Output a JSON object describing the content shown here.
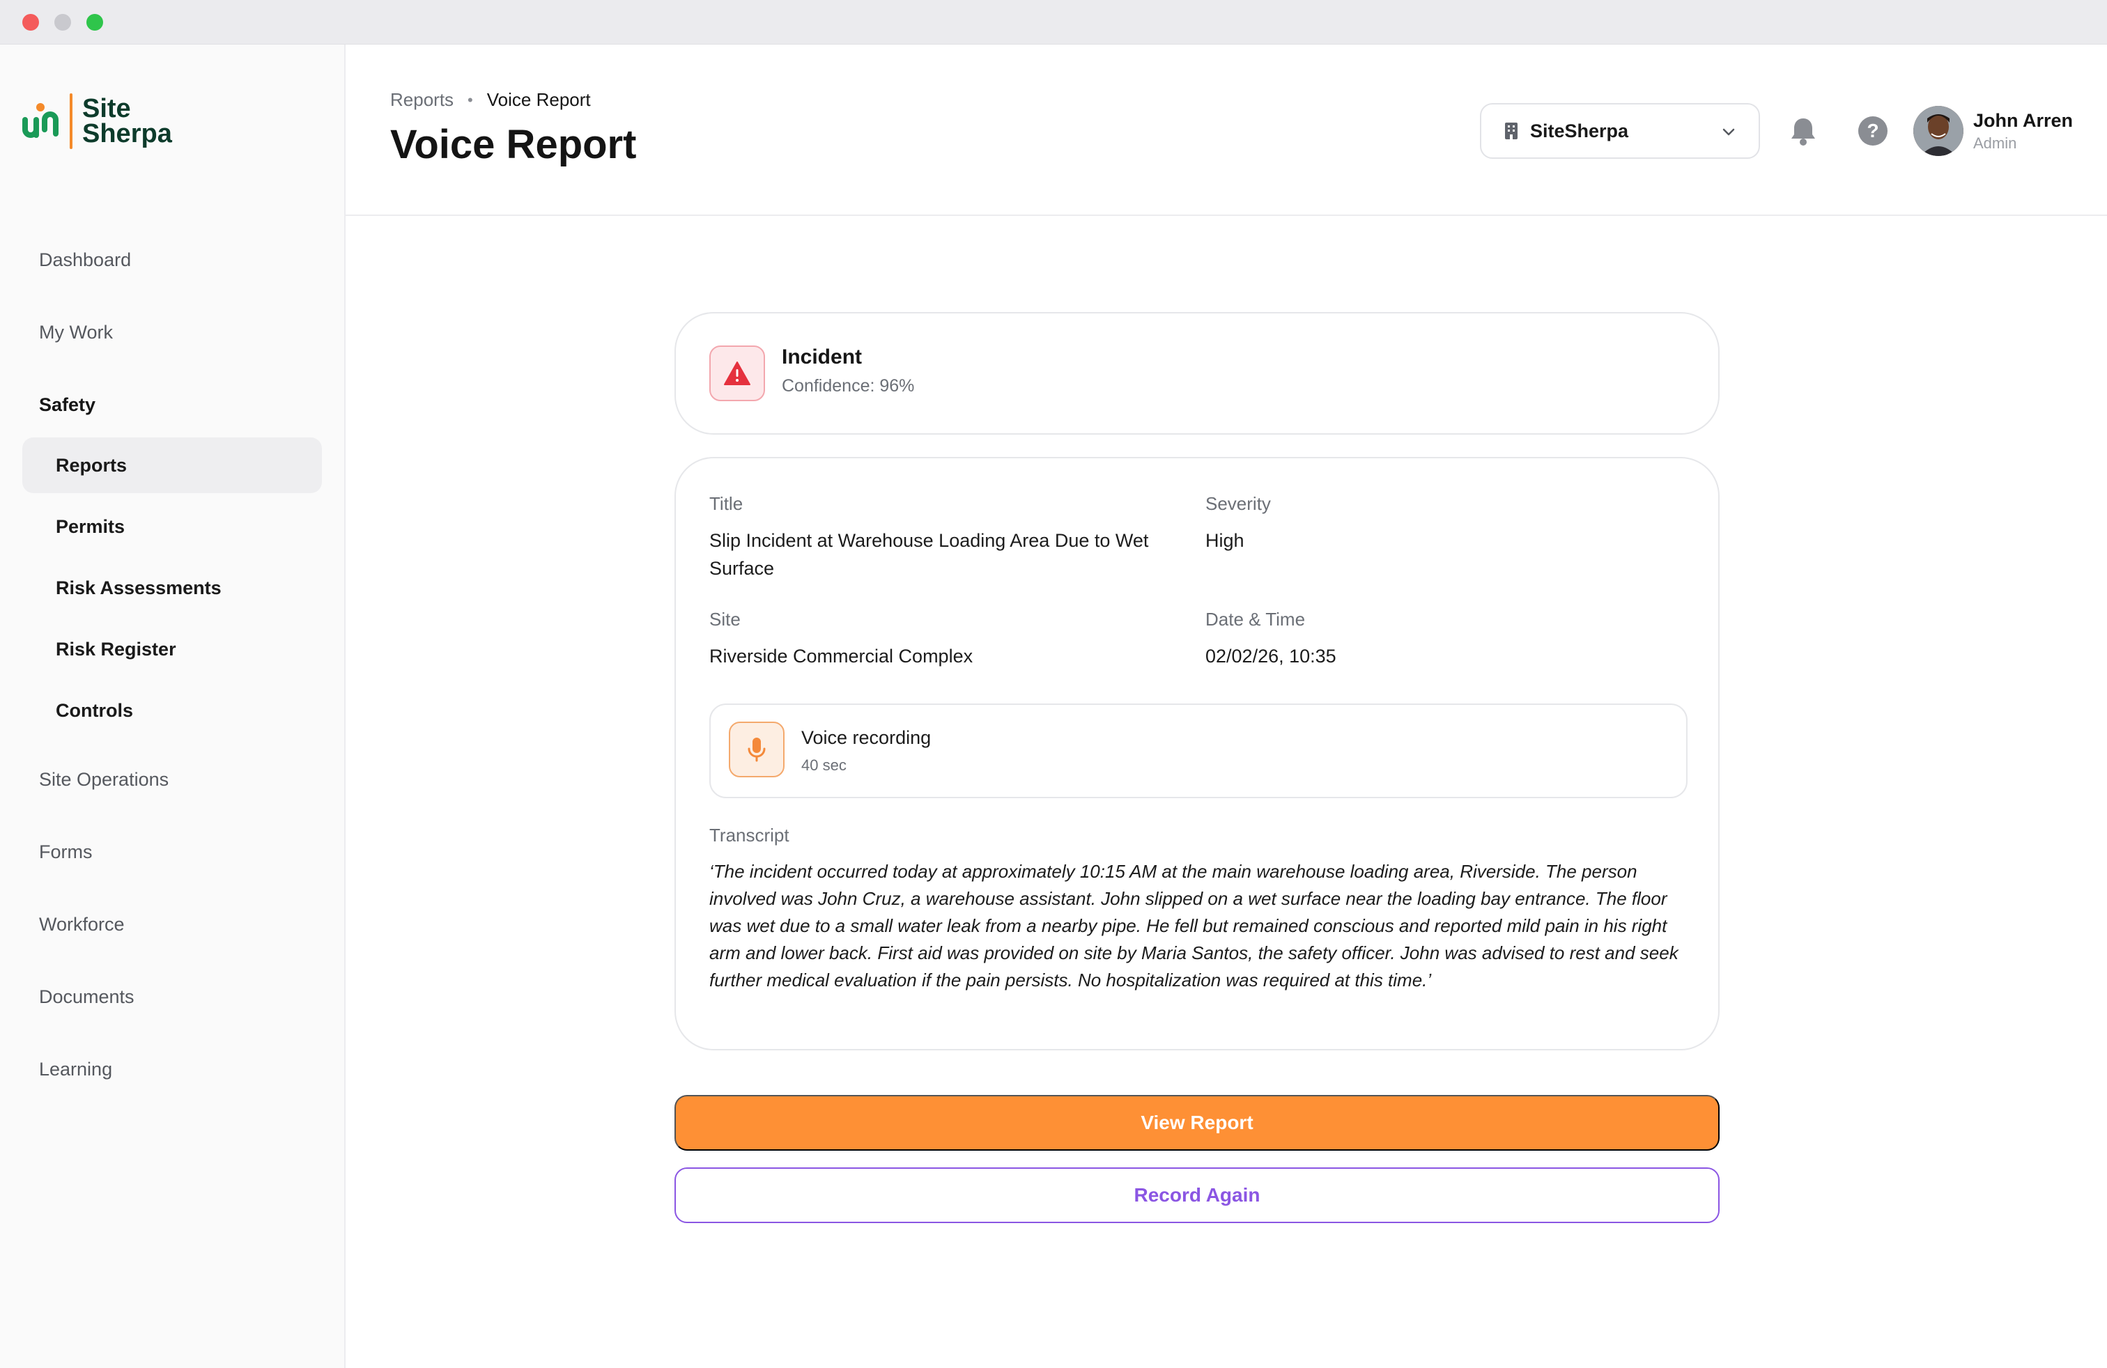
{
  "app": {
    "logo_line1": "Site",
    "logo_line2": "Sherpa",
    "brand_color": "#0d3b2b",
    "accent_color": "#f48a2a"
  },
  "sidebar": {
    "items": [
      {
        "label": "Dashboard"
      },
      {
        "label": "My Work"
      },
      {
        "label": "Safety"
      },
      {
        "label": "Site Operations"
      },
      {
        "label": "Forms"
      },
      {
        "label": "Workforce"
      },
      {
        "label": "Documents"
      },
      {
        "label": "Learning"
      }
    ],
    "safety_children": [
      {
        "label": "Reports",
        "active": true
      },
      {
        "label": "Permits"
      },
      {
        "label": "Risk Assessments"
      },
      {
        "label": "Risk Register"
      },
      {
        "label": "Controls"
      }
    ]
  },
  "header": {
    "breadcrumb_parent": "Reports",
    "breadcrumb_separator": "•",
    "breadcrumb_current": "Voice Report",
    "title": "Voice Report",
    "org_select": {
      "value": "SiteSherpa",
      "icon": "building-icon"
    },
    "user": {
      "name": "John Arren",
      "role": "Admin"
    }
  },
  "classification": {
    "type": "Incident",
    "confidence": "Confidence: 96%",
    "icon": "warning-icon",
    "color": "#e5313e"
  },
  "details": {
    "title_label": "Title",
    "title_value": "Slip Incident at Warehouse Loading Area Due to Wet Surface",
    "severity_label": "Severity",
    "severity_value": "High",
    "site_label": "Site",
    "site_value": "Riverside Commercial Complex",
    "datetime_label": "Date & Time",
    "datetime_value": "02/02/26, 10:35"
  },
  "voice": {
    "title": "Voice recording",
    "length": "40 sec",
    "icon": "microphone-icon"
  },
  "transcript": {
    "label": "Transcript",
    "text": "‘The incident occurred today at approximately 10:15 AM at the main warehouse loading area, Riverside. The person involved was John Cruz, a warehouse assistant. John slipped on a wet surface near the loading bay entrance. The floor was wet due to a small water leak from a nearby pipe. He fell but remained conscious and reported mild pain in his right arm and lower back. First aid was provided on site by Maria Santos, the safety officer. John was advised to rest and seek further medical evaluation if the pain persists. No hospitalization was required at this time.’"
  },
  "actions": {
    "primary_label": "View Report",
    "secondary_label": "Record Again",
    "primary_color": "#fe9035",
    "secondary_color": "#8b56e3"
  }
}
